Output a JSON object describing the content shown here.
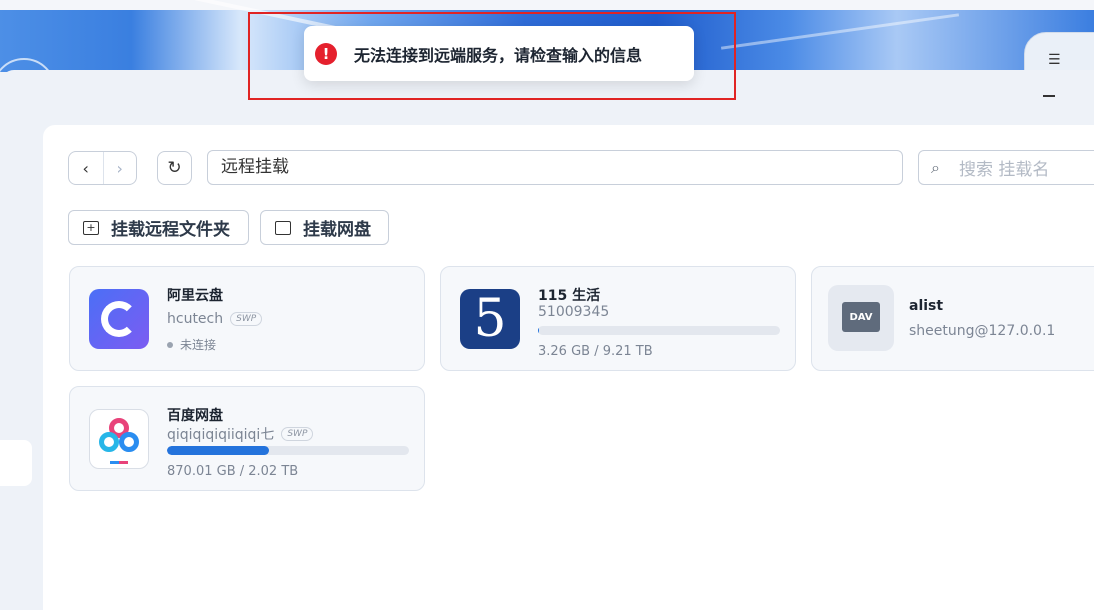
{
  "toast": {
    "message": "无法连接到远端服务，请检查输入的信息",
    "icon": "error-icon"
  },
  "toolbar": {
    "back_icon": "‹",
    "forward_icon": "›",
    "refresh_icon": "↻",
    "path": "远程挂载",
    "search_placeholder": "搜索 挂载名"
  },
  "actions": [
    {
      "label": "挂载远程文件夹",
      "icon": "folder-plus-icon"
    },
    {
      "label": "挂载网盘",
      "icon": "cloud-folder-icon"
    }
  ],
  "mounts": [
    {
      "name": "阿里云盘",
      "account": "hcutech",
      "badge": "SWP",
      "status": "未连接",
      "status_color": "#9aa3b0",
      "logo": "aliyun-drive-logo"
    },
    {
      "name": "115 生活",
      "account": "51009345",
      "usage": "3.26 GB / 9.21 TB",
      "usage_fraction": 0.0004,
      "logo_text": "5"
    },
    {
      "name": "alist",
      "account": "sheetung@127.0.0.1",
      "logo_text": "DAV"
    },
    {
      "name": "百度网盘",
      "account": "qiqiqiqiqiiqiqi七",
      "badge": "SWP",
      "usage": "870.01 GB / 2.02 TB",
      "usage_fraction": 0.42,
      "logo": "baidu-netdisk-logo"
    }
  ],
  "colors": {
    "accent": "#2473dc",
    "error": "#e5202d"
  }
}
